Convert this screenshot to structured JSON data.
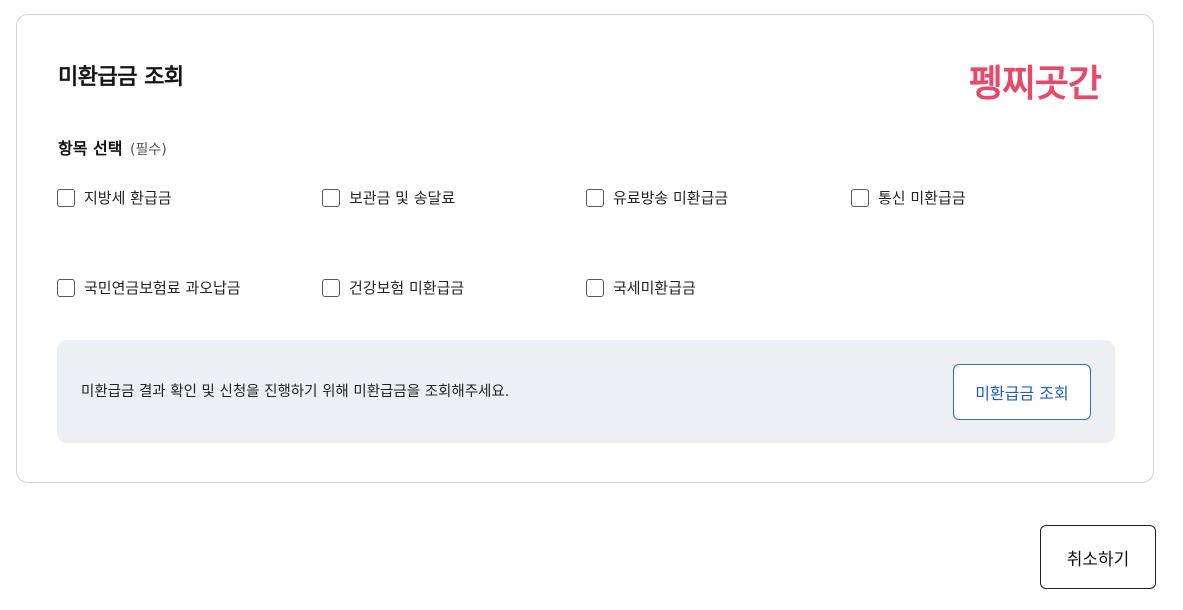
{
  "card": {
    "title": "미환급금 조회",
    "brand": "펭찌곳간"
  },
  "selection": {
    "label": "항목 선택",
    "required_note": "(필수)",
    "options": [
      {
        "label": "지방세 환급금",
        "checked": false
      },
      {
        "label": "보관금 및 송달료",
        "checked": false
      },
      {
        "label": "유료방송 미환급금",
        "checked": false
      },
      {
        "label": "통신 미환급금",
        "checked": false
      },
      {
        "label": "국민연금보험료 과오납금",
        "checked": false
      },
      {
        "label": "건강보험 미환급금",
        "checked": false
      },
      {
        "label": "국세미환급금",
        "checked": false
      }
    ]
  },
  "info": {
    "message": "미환급금 결과 확인 및 신청을 진행하기 위해 미환급금을 조회해주세요.",
    "button_label": "미환급금 조회"
  },
  "footer": {
    "cancel_label": "취소하기"
  },
  "colors": {
    "brand": "#e8496b",
    "accent": "#2f6fd1",
    "info_bg": "#eceff4"
  }
}
